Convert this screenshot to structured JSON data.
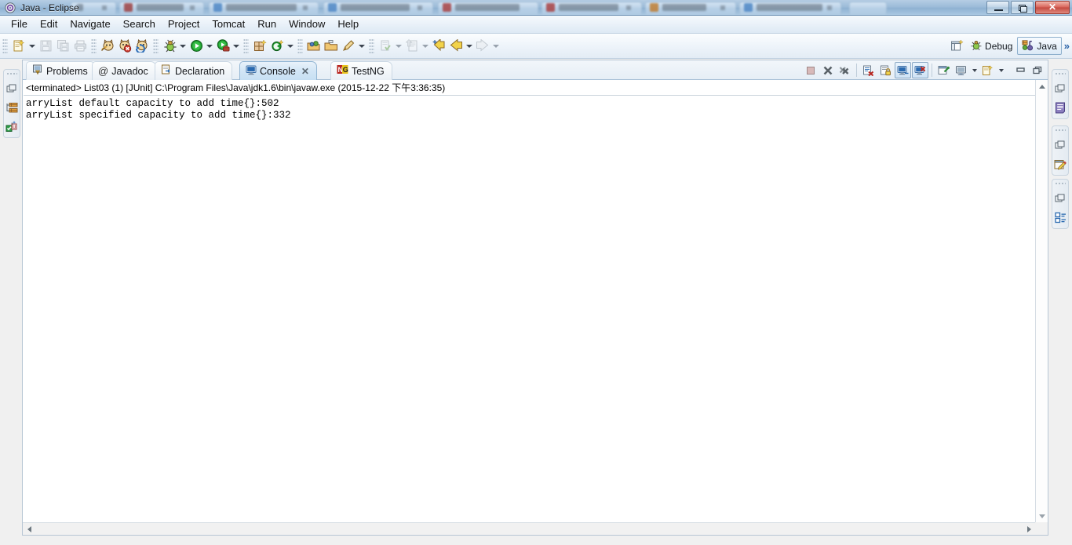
{
  "window": {
    "title": "Java - Eclipse",
    "app_icon": "eclipse-icon",
    "minimize_label": "Minimize",
    "restore_label": "Restore",
    "close_label": "Close",
    "close_glyph": "✕"
  },
  "background_tabs": [
    {
      "name": "blurred-browser-tab-1"
    },
    {
      "name": "blurred-browser-tab-2"
    },
    {
      "name": "blurred-browser-tab-3"
    },
    {
      "name": "blurred-browser-tab-4"
    },
    {
      "name": "blurred-browser-tab-5"
    },
    {
      "name": "blurred-browser-tab-6"
    },
    {
      "name": "blurred-browser-tab-7"
    },
    {
      "name": "blurred-browser-tab-8"
    }
  ],
  "menubar": {
    "items": [
      {
        "label": "File"
      },
      {
        "label": "Edit"
      },
      {
        "label": "Navigate"
      },
      {
        "label": "Search"
      },
      {
        "label": "Project"
      },
      {
        "label": "Tomcat"
      },
      {
        "label": "Run"
      },
      {
        "label": "Window"
      },
      {
        "label": "Help"
      }
    ]
  },
  "toolbar": {
    "groups": [
      {
        "icons": [
          "new-wizard-icon",
          "save-icon",
          "save-all-icon",
          "print-icon"
        ]
      },
      {
        "icons": [
          "tomcat-start-icon",
          "tomcat-stop-icon",
          "tomcat-restart-icon"
        ]
      },
      {
        "icons": [
          "debug-icon",
          "run-icon",
          "external-tools-icon"
        ]
      },
      {
        "icons": [
          "new-java-package-icon",
          "new-java-class-icon"
        ]
      },
      {
        "icons": [
          "open-type-icon",
          "open-task-icon",
          "search-icon"
        ]
      },
      {
        "icons": [
          "next-annotation-icon",
          "previous-annotation-icon",
          "last-edit-location-icon",
          "back-icon",
          "forward-icon"
        ]
      }
    ],
    "perspective": {
      "open_perspective_label": "open-perspective-icon",
      "debug_label": "Debug",
      "java_label": "Java",
      "overflow_glyph": "»"
    }
  },
  "left_fastview": {
    "groups": [
      {
        "icons": [
          "restore-icon",
          "package-explorer-icon",
          "junit-icon"
        ]
      }
    ]
  },
  "right_fastview": {
    "groups": [
      {
        "icons": [
          "restore-icon",
          "outline-document-icon"
        ]
      },
      {
        "icons": [
          "restore-icon",
          "editor-pencil-icon"
        ]
      },
      {
        "icons": [
          "restore-icon",
          "outline-tree-icon"
        ]
      }
    ]
  },
  "view_tabs": [
    {
      "label": "Problems",
      "icon": "problems-icon",
      "active": false,
      "closable": false
    },
    {
      "label": "Javadoc",
      "icon": "javadoc-at-icon",
      "active": false,
      "closable": false
    },
    {
      "label": "Declaration",
      "icon": "declaration-icon",
      "active": false,
      "closable": false
    },
    {
      "label": "Console",
      "icon": "console-icon",
      "active": true,
      "closable": true,
      "close_glyph": "✕"
    },
    {
      "label": "TestNG",
      "icon": "testng-icon",
      "active": false,
      "closable": false
    }
  ],
  "console_toolbar": {
    "buttons": [
      {
        "name": "terminate-button",
        "icon": "terminate-icon",
        "enabled": false,
        "toggled": false
      },
      {
        "name": "remove-launch-button",
        "icon": "remove-icon",
        "enabled": true,
        "toggled": false
      },
      {
        "name": "remove-all-terminated-button",
        "icon": "remove-all-icon",
        "enabled": true,
        "toggled": false
      },
      {
        "name": "clear-console-button",
        "icon": "clear-console-icon",
        "enabled": true,
        "toggled": false
      },
      {
        "name": "scroll-lock-button",
        "icon": "scroll-lock-icon",
        "enabled": true,
        "toggled": false
      },
      {
        "name": "show-console-on-output-button",
        "icon": "show-console-output-icon",
        "enabled": true,
        "toggled": true
      },
      {
        "name": "show-console-on-error-button",
        "icon": "show-console-error-icon",
        "enabled": true,
        "toggled": true
      },
      {
        "name": "pin-console-button",
        "icon": "pin-console-icon",
        "enabled": true,
        "toggled": false
      },
      {
        "name": "display-selected-console-button",
        "icon": "display-console-icon",
        "enabled": true,
        "toggled": false
      },
      {
        "name": "open-console-button",
        "icon": "open-console-icon",
        "enabled": true,
        "toggled": false
      }
    ],
    "minimize_label": "minimize-icon",
    "maximize_label": "maximize-icon"
  },
  "console": {
    "header": "<terminated> List03 (1) [JUnit] C:\\Program Files\\Java\\jdk1.6\\bin\\javaw.exe (2015-12-22 下午3:36:35)",
    "lines": [
      "arryList default capacity to add time{}:502",
      "arryList specified capacity to add time{}:332"
    ]
  },
  "colors": {
    "title_bar": "#9dbcd9",
    "menu_bar": "#e8f0f8",
    "toolbar": "#eef4fa",
    "active_tab": "#d3e6f6",
    "console_bg": "#ffffff",
    "close_button": "#c44a40",
    "accent_blue": "#2b63a8"
  }
}
